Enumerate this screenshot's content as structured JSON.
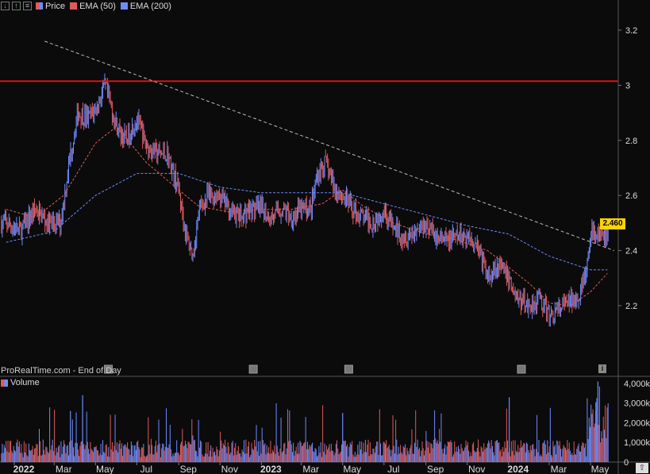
{
  "toolbar": {
    "price_label": "Price",
    "ema50_label": "EMA (50)",
    "ema200_label": "EMA (200)",
    "price_color": "#6e8cff",
    "ema50_color": "#e05a5a",
    "ema200_color": "#6e8cff",
    "icons": [
      "down-arrow-icon",
      "up-arrow-icon",
      "settings-icon"
    ]
  },
  "watermark": "ProRealTime.com - End of Day",
  "price_badge": "2.460",
  "volume_label": "Volume",
  "colors": {
    "resistance": "#e01010",
    "trendline": "#bbbbbb",
    "up_candle": "#6e8cff",
    "down_candle": "#e05a5a"
  },
  "chart_data": {
    "type": "line",
    "x_ticks": [
      "2022",
      "Mar",
      "May",
      "Jul",
      "Sep",
      "Nov",
      "2023",
      "Mar",
      "May",
      "Jul",
      "Sep",
      "Nov",
      "2024",
      "Mar",
      "May"
    ],
    "y_ticks": [
      "3.2",
      "3",
      "2.8",
      "2.6",
      "2.4",
      "2.2"
    ],
    "ylim": [
      2.07,
      3.3
    ],
    "volume_ticks": [
      "4,000k",
      "3,000k",
      "2,000k",
      "1,000k",
      "0"
    ],
    "volume_ylim": [
      0,
      4200
    ],
    "resistance_level": 3.015,
    "trendline": {
      "start": [
        "2022-02-15",
        3.16
      ],
      "end": [
        "2024-06-05",
        2.4
      ]
    },
    "series": [
      {
        "name": "Price",
        "x": [
          "2021-12-20",
          "2022-01-10",
          "2022-02-01",
          "2022-02-20",
          "2022-03-10",
          "2022-03-25",
          "2022-04-05",
          "2022-04-20",
          "2022-05-03",
          "2022-05-15",
          "2022-06-01",
          "2022-06-15",
          "2022-07-01",
          "2022-07-15",
          "2022-08-01",
          "2022-08-15",
          "2022-09-01",
          "2022-09-12",
          "2022-09-22",
          "2022-10-01",
          "2022-10-15",
          "2022-11-01",
          "2022-11-15",
          "2022-12-01",
          "2022-12-15",
          "2023-01-01",
          "2023-01-15",
          "2023-02-01",
          "2023-02-15",
          "2023-03-01",
          "2023-03-15",
          "2023-03-25",
          "2023-04-05",
          "2023-04-20",
          "2023-05-01",
          "2023-05-15",
          "2023-06-01",
          "2023-06-15",
          "2023-07-01",
          "2023-07-15",
          "2023-08-01",
          "2023-08-15",
          "2023-09-01",
          "2023-09-15",
          "2023-10-01",
          "2023-10-15",
          "2023-11-01",
          "2023-11-15",
          "2023-12-01",
          "2023-12-15",
          "2024-01-01",
          "2024-01-15",
          "2024-02-01",
          "2024-02-15",
          "2024-03-01",
          "2024-03-12",
          "2024-03-22",
          "2024-04-05",
          "2024-04-15",
          "2024-04-25",
          "2024-05-03",
          "2024-05-10",
          "2024-05-20",
          "2024-05-27"
        ],
        "values": [
          2.5,
          2.47,
          2.55,
          2.5,
          2.5,
          2.75,
          2.9,
          2.88,
          2.92,
          3.0,
          2.85,
          2.8,
          2.88,
          2.78,
          2.75,
          2.75,
          2.62,
          2.45,
          2.38,
          2.55,
          2.6,
          2.6,
          2.55,
          2.52,
          2.55,
          2.55,
          2.52,
          2.55,
          2.52,
          2.55,
          2.55,
          2.68,
          2.72,
          2.62,
          2.6,
          2.55,
          2.52,
          2.5,
          2.55,
          2.48,
          2.45,
          2.47,
          2.5,
          2.45,
          2.43,
          2.45,
          2.45,
          2.43,
          2.3,
          2.35,
          2.3,
          2.22,
          2.2,
          2.23,
          2.16,
          2.18,
          2.2,
          2.22,
          2.25,
          2.32,
          2.48,
          2.45,
          2.46,
          2.46
        ]
      },
      {
        "name": "EMA (50)",
        "x": [
          "2021-12-20",
          "2022-02-01",
          "2022-03-15",
          "2022-05-01",
          "2022-06-01",
          "2022-07-15",
          "2022-09-01",
          "2022-10-01",
          "2022-11-15",
          "2023-01-01",
          "2023-02-15",
          "2023-04-01",
          "2023-05-01",
          "2023-06-01",
          "2023-07-15",
          "2023-09-01",
          "2023-10-15",
          "2023-12-01",
          "2024-01-01",
          "2024-02-01",
          "2024-03-01",
          "2024-04-01",
          "2024-05-01",
          "2024-05-27"
        ],
        "values": [
          2.55,
          2.52,
          2.6,
          2.79,
          2.85,
          2.72,
          2.62,
          2.56,
          2.54,
          2.55,
          2.55,
          2.57,
          2.62,
          2.56,
          2.5,
          2.46,
          2.44,
          2.4,
          2.34,
          2.28,
          2.21,
          2.2,
          2.25,
          2.32
        ]
      },
      {
        "name": "EMA (200)",
        "x": [
          "2021-12-20",
          "2022-03-01",
          "2022-05-01",
          "2022-07-01",
          "2022-09-01",
          "2022-11-01",
          "2023-01-01",
          "2023-03-01",
          "2023-05-01",
          "2023-07-01",
          "2023-09-01",
          "2023-11-01",
          "2024-01-01",
          "2024-03-01",
          "2024-05-01",
          "2024-05-27"
        ],
        "values": [
          2.43,
          2.47,
          2.6,
          2.68,
          2.68,
          2.63,
          2.61,
          2.61,
          2.61,
          2.57,
          2.53,
          2.49,
          2.46,
          2.38,
          2.33,
          2.33
        ]
      }
    ]
  }
}
